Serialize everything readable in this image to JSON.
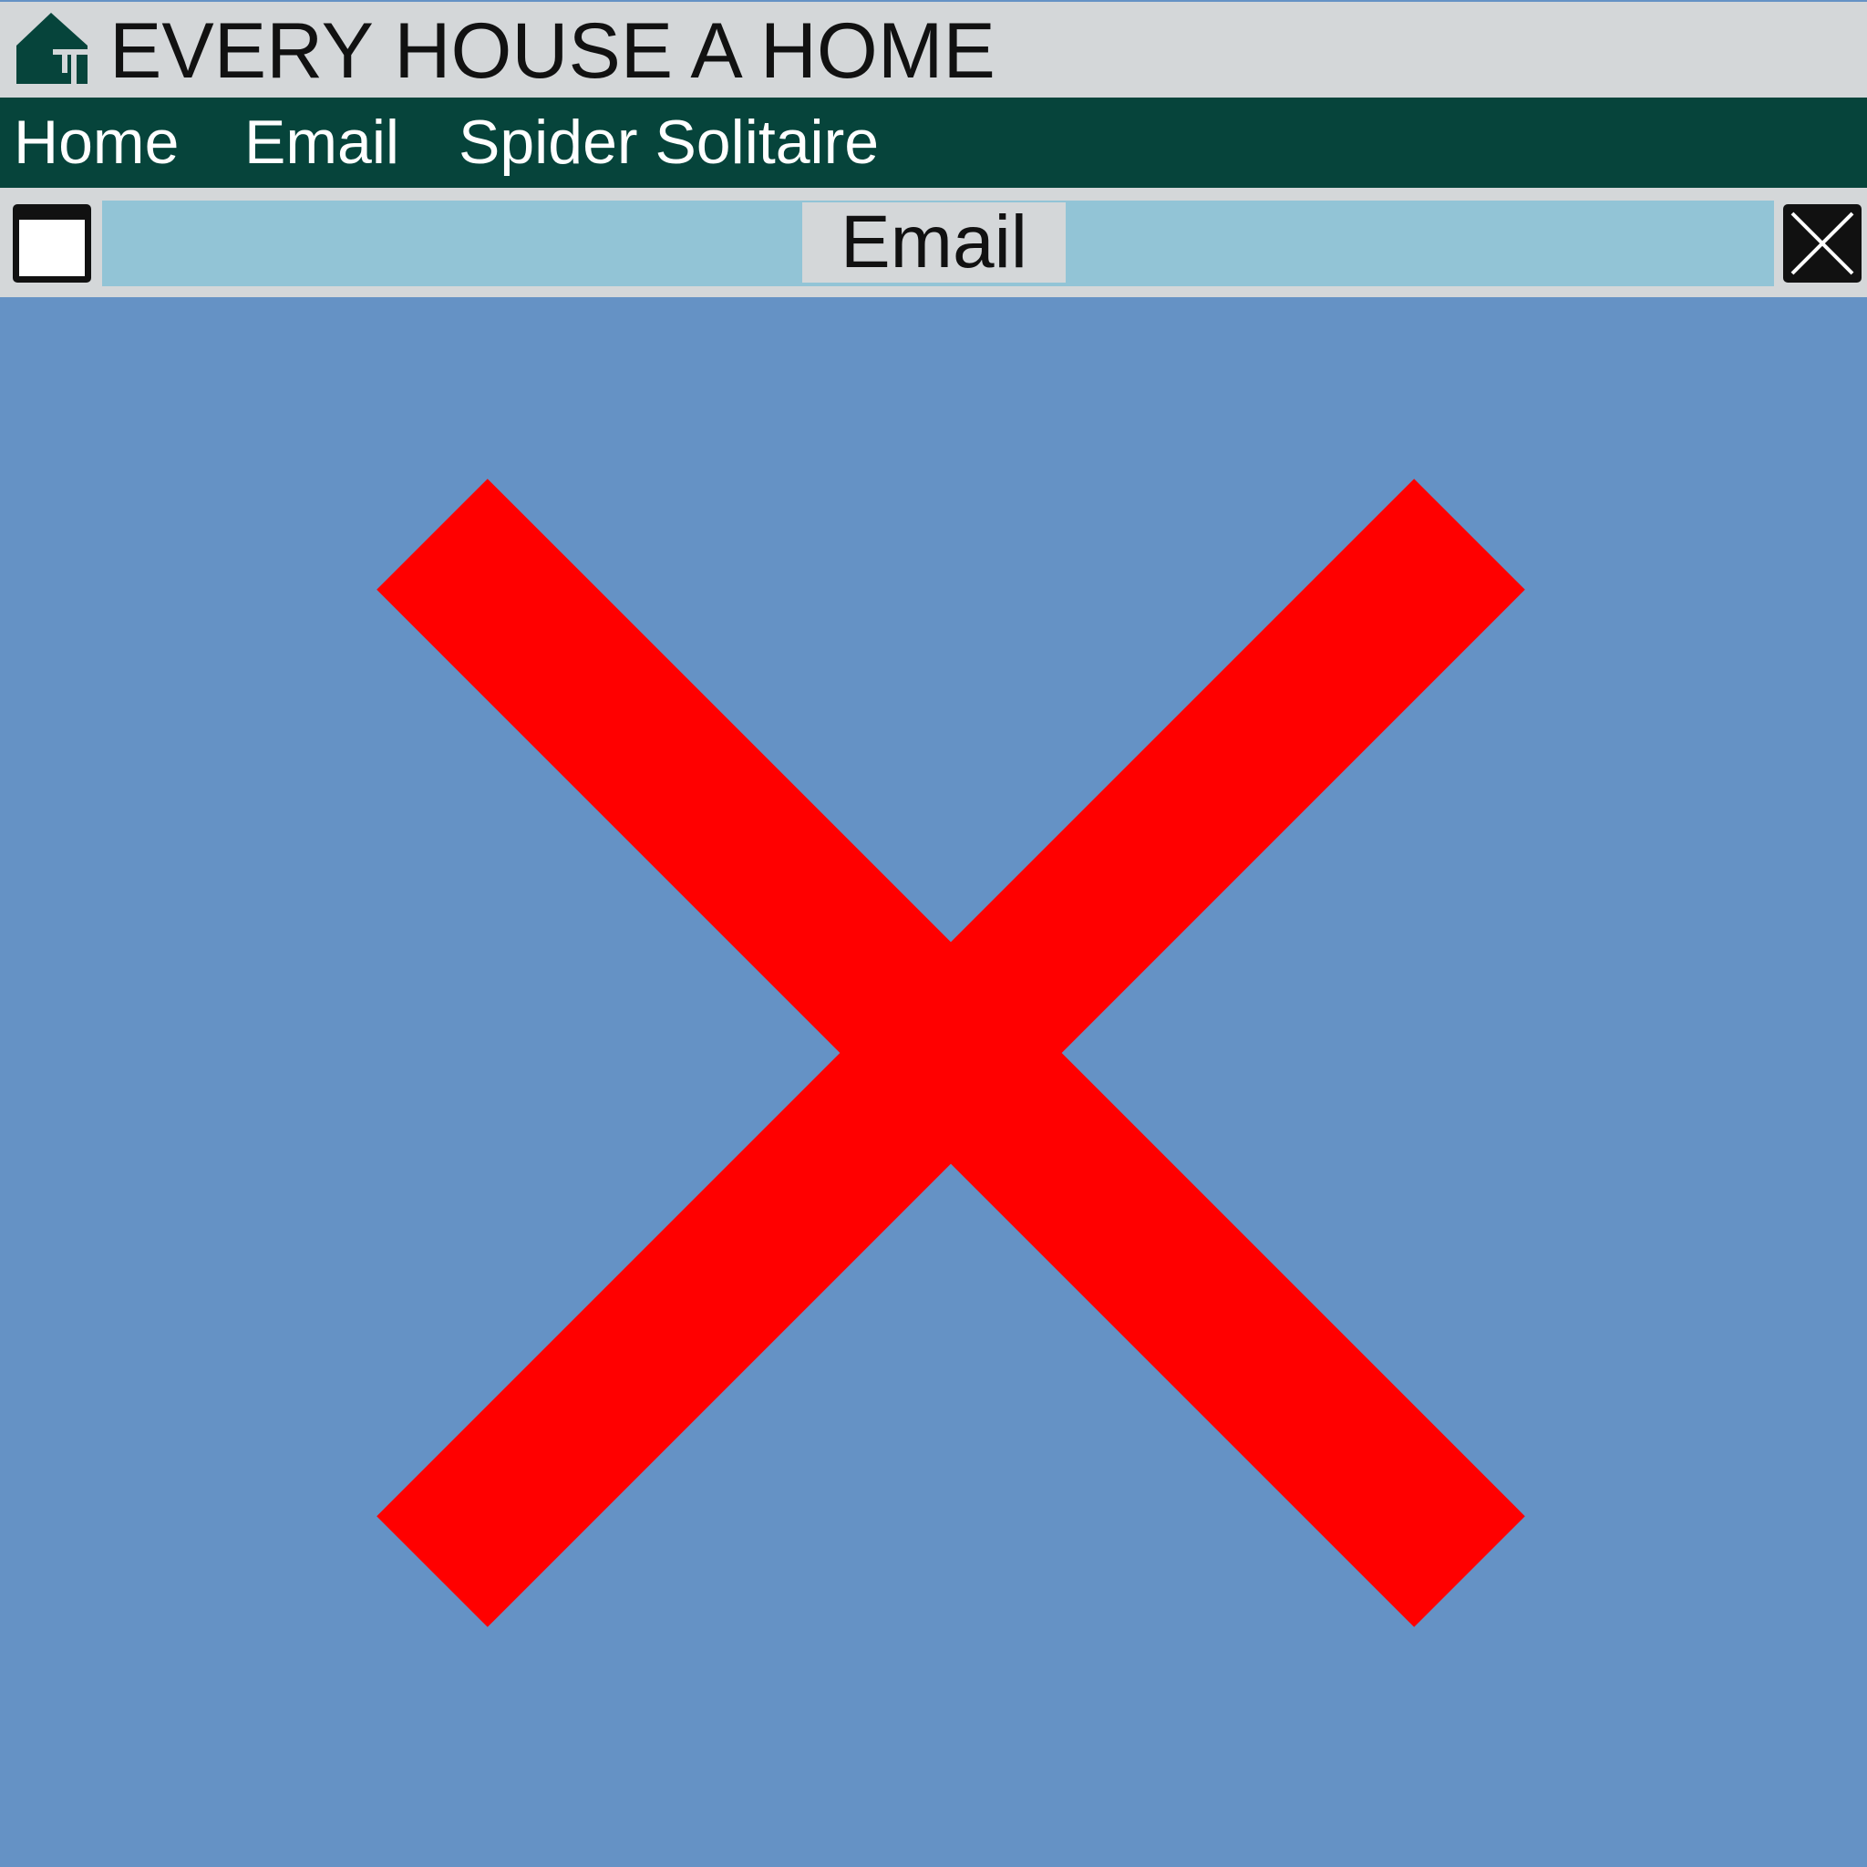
{
  "header": {
    "brand_title": "EVERY HOUSE A HOME",
    "logo_icon": "house-logo-icon"
  },
  "nav": {
    "items": [
      {
        "label": "Home"
      },
      {
        "label": "Email"
      },
      {
        "label": "Spider Solitaire"
      }
    ]
  },
  "window": {
    "title": "Email",
    "left_button_icon": "window-icon",
    "right_button_icon": "close-icon"
  },
  "content": {
    "status_icon": "error-x-icon"
  },
  "colors": {
    "desktop_background": "#6592c5",
    "nav_background": "#06443b",
    "title_track": "#92c4d6",
    "chrome_gray": "#d4d7d9",
    "error_red": "#ff0000"
  }
}
